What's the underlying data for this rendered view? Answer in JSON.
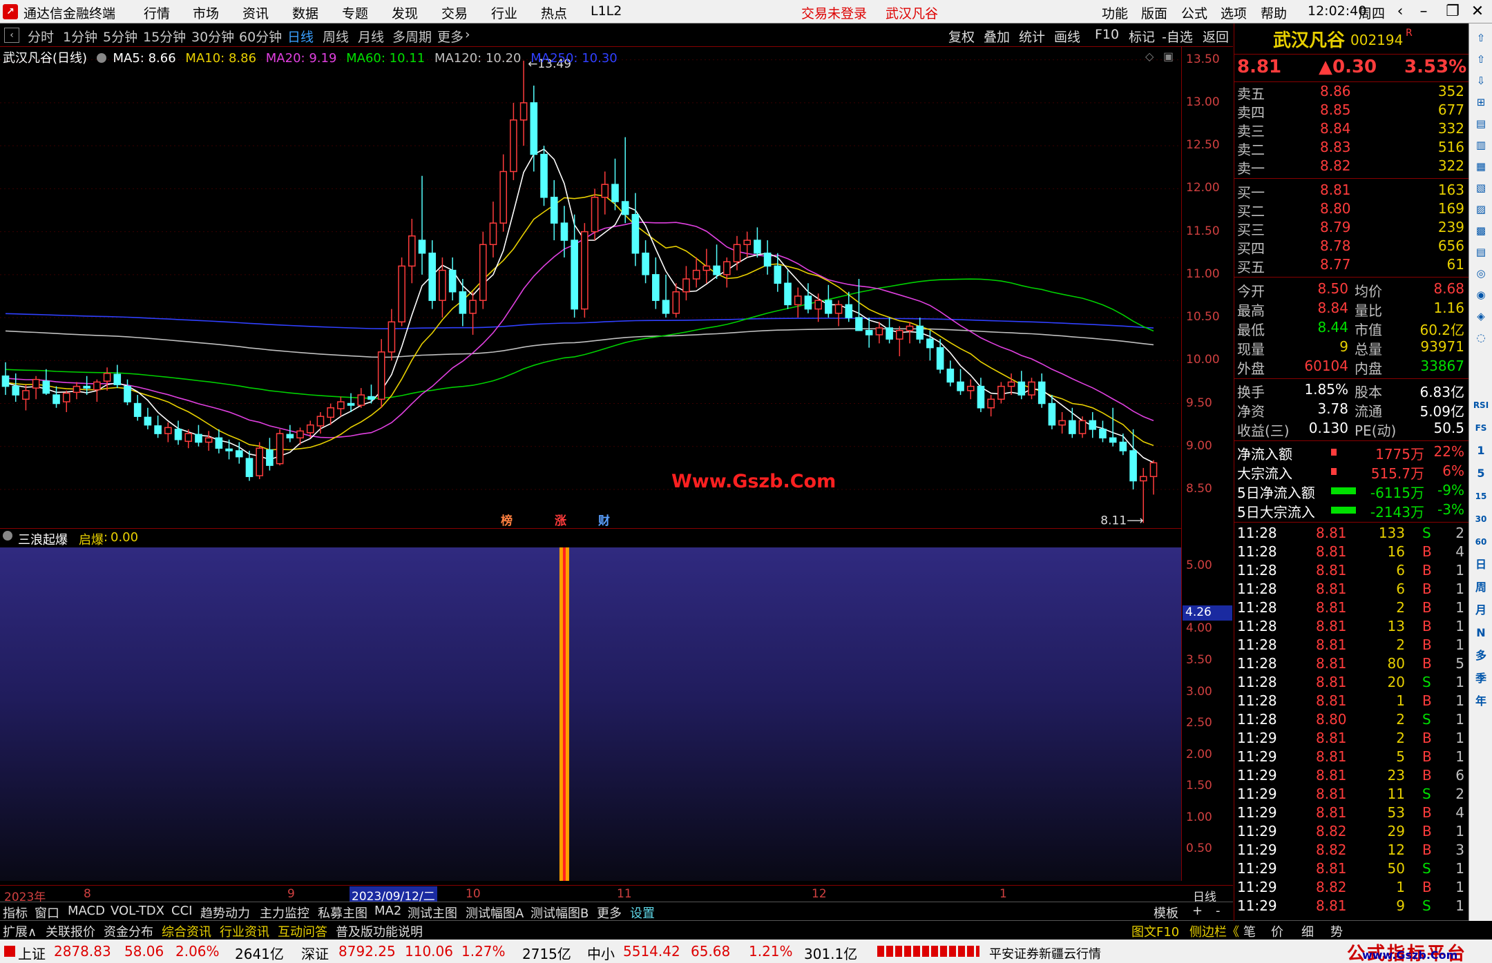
{
  "app": {
    "title": "通达信金融终端",
    "login_status": "交易未登录",
    "stock_name_menu": "武汉凡谷",
    "time": "12:02:40",
    "weekday": "周四"
  },
  "menu": [
    "行情",
    "市场",
    "资讯",
    "数据",
    "专题",
    "发现",
    "交易",
    "行业",
    "热点",
    "L1L2"
  ],
  "menu_right": [
    "功能",
    "版面",
    "公式",
    "选项",
    "帮助"
  ],
  "periods": [
    "分时",
    "1分钟",
    "5分钟",
    "15分钟",
    "30分钟",
    "60分钟",
    "日线",
    "周线",
    "月线",
    "多周期",
    "更多"
  ],
  "active_period": "日线",
  "toolbar_right": [
    "复权",
    "叠加",
    "统计",
    "画线",
    "F10",
    "标记",
    "-自选",
    "返回"
  ],
  "legend": {
    "title": "武汉凡谷(日线)",
    "ma5": "MA5: 8.66",
    "ma10": "MA10: 8.86",
    "ma20": "MA20: 9.19",
    "ma60": "MA60: 10.11",
    "ma120": "MA120: 10.20",
    "ma250": "MA250: 10.30"
  },
  "colors": {
    "up": "#ff3c3c",
    "down": "#54ffff",
    "ma5": "#ffffff",
    "ma10": "#e8d000",
    "ma20": "#e040e0",
    "ma60": "#00d000",
    "ma120": "#c0c0c0",
    "ma250": "#3040ff",
    "indicator_bar": "#ffa000"
  },
  "chart_data": {
    "type": "candlestick",
    "yticks": [
      "13.50",
      "13.00",
      "12.50",
      "12.00",
      "11.50",
      "11.00",
      "10.50",
      "10.00",
      "9.50",
      "9.00",
      "8.50"
    ],
    "ylim": [
      8.05,
      13.65
    ],
    "high_label": "13.49",
    "low_label": "8.11",
    "watermark": "Www.Gszb.Com",
    "markers": [
      {
        "text": "榜",
        "color": "#ff8040"
      },
      {
        "text": "涨",
        "color": "#ff3c3c"
      },
      {
        "text": "财",
        "color": "#5aa0ff"
      }
    ],
    "ohlc": [
      [
        9.82,
        9.98,
        9.6,
        9.7
      ],
      [
        9.7,
        9.85,
        9.52,
        9.6
      ],
      [
        9.55,
        9.72,
        9.42,
        9.65
      ],
      [
        9.68,
        9.82,
        9.55,
        9.78
      ],
      [
        9.76,
        9.9,
        9.6,
        9.62
      ],
      [
        9.6,
        9.7,
        9.45,
        9.5
      ],
      [
        9.52,
        9.65,
        9.4,
        9.62
      ],
      [
        9.63,
        9.75,
        9.55,
        9.7
      ],
      [
        9.7,
        9.82,
        9.6,
        9.68
      ],
      [
        9.66,
        9.78,
        9.52,
        9.75
      ],
      [
        9.76,
        9.92,
        9.65,
        9.85
      ],
      [
        9.84,
        9.95,
        9.68,
        9.72
      ],
      [
        9.7,
        9.78,
        9.48,
        9.52
      ],
      [
        9.5,
        9.6,
        9.3,
        9.35
      ],
      [
        9.34,
        9.45,
        9.2,
        9.25
      ],
      [
        9.24,
        9.36,
        9.1,
        9.15
      ],
      [
        9.15,
        9.28,
        9.05,
        9.22
      ],
      [
        9.2,
        9.3,
        9.02,
        9.08
      ],
      [
        9.06,
        9.2,
        8.98,
        9.15
      ],
      [
        9.14,
        9.25,
        9.0,
        9.05
      ],
      [
        9.05,
        9.18,
        8.95,
        9.1
      ],
      [
        9.1,
        9.2,
        8.92,
        8.98
      ],
      [
        8.97,
        9.08,
        8.85,
        8.95
      ],
      [
        8.95,
        9.05,
        8.8,
        8.88
      ],
      [
        8.86,
        8.95,
        8.6,
        8.65
      ],
      [
        8.66,
        9.05,
        8.62,
        8.98
      ],
      [
        8.96,
        9.1,
        8.72,
        8.78
      ],
      [
        8.8,
        9.2,
        8.78,
        9.15
      ],
      [
        9.14,
        9.25,
        9.05,
        9.1
      ],
      [
        9.1,
        9.22,
        9.02,
        9.18
      ],
      [
        9.16,
        9.3,
        9.1,
        9.25
      ],
      [
        9.24,
        9.4,
        9.15,
        9.35
      ],
      [
        9.34,
        9.5,
        9.25,
        9.45
      ],
      [
        9.44,
        9.58,
        9.35,
        9.52
      ],
      [
        9.5,
        9.62,
        9.4,
        9.48
      ],
      [
        9.48,
        9.68,
        9.45,
        9.6
      ],
      [
        9.58,
        9.72,
        9.5,
        9.55
      ],
      [
        9.55,
        10.25,
        9.45,
        10.1
      ],
      [
        10.1,
        10.6,
        10.0,
        10.45
      ],
      [
        10.45,
        11.2,
        10.4,
        11.1
      ],
      [
        11.1,
        11.65,
        10.9,
        11.45
      ],
      [
        11.4,
        12.15,
        11.0,
        11.25
      ],
      [
        11.25,
        11.4,
        10.6,
        10.7
      ],
      [
        10.7,
        11.2,
        10.5,
        11.05
      ],
      [
        11.05,
        11.2,
        10.7,
        10.8
      ],
      [
        10.8,
        10.95,
        10.4,
        10.55
      ],
      [
        10.55,
        10.8,
        10.3,
        10.7
      ],
      [
        10.7,
        11.5,
        10.6,
        11.35
      ],
      [
        11.35,
        11.85,
        11.2,
        11.6
      ],
      [
        11.6,
        12.4,
        11.5,
        12.2
      ],
      [
        12.2,
        13.0,
        12.1,
        12.8
      ],
      [
        12.8,
        13.49,
        12.5,
        13.0
      ],
      [
        13.0,
        13.2,
        12.2,
        12.4
      ],
      [
        12.4,
        12.5,
        11.8,
        11.9
      ],
      [
        11.9,
        12.1,
        11.4,
        11.6
      ],
      [
        11.6,
        11.8,
        11.2,
        11.4
      ],
      [
        11.4,
        11.7,
        10.5,
        10.6
      ],
      [
        10.6,
        11.6,
        10.5,
        11.5
      ],
      [
        11.5,
        12.0,
        11.4,
        11.9
      ],
      [
        11.9,
        12.2,
        11.7,
        12.05
      ],
      [
        12.05,
        12.35,
        11.75,
        11.85
      ],
      [
        11.85,
        12.6,
        11.6,
        11.7
      ],
      [
        11.7,
        11.95,
        11.1,
        11.25
      ],
      [
        11.25,
        11.4,
        10.9,
        11.0
      ],
      [
        11.0,
        11.2,
        10.6,
        10.7
      ],
      [
        10.7,
        11.0,
        10.5,
        10.55
      ],
      [
        10.55,
        10.9,
        10.5,
        10.8
      ],
      [
        10.8,
        11.1,
        10.7,
        10.95
      ],
      [
        10.95,
        11.2,
        10.85,
        11.05
      ],
      [
        11.05,
        11.3,
        10.9,
        11.1
      ],
      [
        11.1,
        11.35,
        10.95,
        11.0
      ],
      [
        11.0,
        11.2,
        10.85,
        11.15
      ],
      [
        11.15,
        11.45,
        11.05,
        11.35
      ],
      [
        11.35,
        11.5,
        11.2,
        11.4
      ],
      [
        11.4,
        11.55,
        11.2,
        11.25
      ],
      [
        11.25,
        11.4,
        11.0,
        11.1
      ],
      [
        11.1,
        11.25,
        10.8,
        10.9
      ],
      [
        10.9,
        11.05,
        10.6,
        10.65
      ],
      [
        10.65,
        10.85,
        10.5,
        10.75
      ],
      [
        10.75,
        10.9,
        10.55,
        10.6
      ],
      [
        10.6,
        10.78,
        10.45,
        10.7
      ],
      [
        10.7,
        10.88,
        10.5,
        10.55
      ],
      [
        10.55,
        10.7,
        10.4,
        10.65
      ],
      [
        10.65,
        10.8,
        10.45,
        10.5
      ],
      [
        10.5,
        10.95,
        10.4,
        10.35
      ],
      [
        10.35,
        10.5,
        10.15,
        10.3
      ],
      [
        10.3,
        10.45,
        10.2,
        10.38
      ],
      [
        10.38,
        10.5,
        10.2,
        10.25
      ],
      [
        10.25,
        10.4,
        10.05,
        10.35
      ],
      [
        10.35,
        10.45,
        10.2,
        10.4
      ],
      [
        10.4,
        10.5,
        10.2,
        10.25
      ],
      [
        10.25,
        10.35,
        10.0,
        10.15
      ],
      [
        10.15,
        10.25,
        9.85,
        9.9
      ],
      [
        9.9,
        10.0,
        9.7,
        9.75
      ],
      [
        9.75,
        9.9,
        9.6,
        9.65
      ],
      [
        9.65,
        9.78,
        9.55,
        9.7
      ],
      [
        9.7,
        9.8,
        9.4,
        9.45
      ],
      [
        9.45,
        9.6,
        9.35,
        9.55
      ],
      [
        9.55,
        9.75,
        9.5,
        9.7
      ],
      [
        9.7,
        9.85,
        9.6,
        9.75
      ],
      [
        9.75,
        9.88,
        9.55,
        9.6
      ],
      [
        9.6,
        9.8,
        9.55,
        9.75
      ],
      [
        9.75,
        9.85,
        9.45,
        9.5
      ],
      [
        9.5,
        9.6,
        9.2,
        9.25
      ],
      [
        9.25,
        9.4,
        9.15,
        9.3
      ],
      [
        9.3,
        9.45,
        9.1,
        9.15
      ],
      [
        9.15,
        9.35,
        9.1,
        9.3
      ],
      [
        9.3,
        9.4,
        9.1,
        9.2
      ],
      [
        9.2,
        9.3,
        9.05,
        9.1
      ],
      [
        9.1,
        9.45,
        9.0,
        9.05
      ],
      [
        9.05,
        9.15,
        8.9,
        8.95
      ],
      [
        8.95,
        9.2,
        8.5,
        8.6
      ],
      [
        8.6,
        8.75,
        8.11,
        8.65
      ],
      [
        8.65,
        8.84,
        8.44,
        8.81
      ]
    ],
    "indicator": {
      "name": "三浪起爆",
      "label": "启爆",
      "value": "0.00",
      "yticks": [
        "5.00",
        "4.00",
        "3.50",
        "3.00",
        "2.50",
        "2.00",
        "1.50",
        "1.00",
        "0.50"
      ],
      "current_label": "4.26",
      "current_value": 4.26,
      "ylim": [
        0,
        5.3
      ],
      "signal_index": 55
    }
  },
  "xaxis": {
    "labels": [
      "2023年",
      "8",
      "9",
      "2023/09/12/二",
      "10",
      "11",
      "12",
      "1"
    ],
    "period": "日线"
  },
  "indicator_tabs": [
    "指标",
    "窗口",
    "MACD",
    "VOL-TDX",
    "CCI",
    "趋势动力",
    "主力监控",
    "私募主图",
    "MA2",
    "测试主图",
    "测试幅图A",
    "测试幅图B",
    "更多",
    "设置"
  ],
  "indicator_tabs_right": [
    "模板",
    "+",
    "-"
  ],
  "bottom_tabs": [
    "扩展∧",
    "关联报价",
    "资金分布",
    "综合资讯",
    "行业资讯",
    "互动问答",
    "普及版功能说明"
  ],
  "bottom_tabs_right": [
    "图文F10",
    "侧边栏《",
    "笔",
    "价",
    "细",
    "势"
  ],
  "status": {
    "sh": {
      "label": "上证",
      "price": "2878.83",
      "chg": "58.06",
      "pct": "2.06%",
      "amt": "2641亿"
    },
    "sz": {
      "label": "深证",
      "price": "8792.25",
      "chg": "110.06",
      "pct": "1.27%",
      "amt": "2715亿"
    },
    "zx": {
      "label": "中小",
      "price": "5514.42",
      "chg": "65.68",
      "pct": "1.21%",
      "amt": "301.1亿"
    },
    "broker": "平安证券新疆云行情",
    "watermark": "公式指标平台",
    "watermark_url": "www.Gszb.Com"
  },
  "quote": {
    "name": "武汉凡谷",
    "code": "002194",
    "flag": "R",
    "price": "8.81",
    "change": "▲0.30",
    "pct": "3.53%",
    "asks": [
      [
        "卖五",
        "8.86",
        "352"
      ],
      [
        "卖四",
        "8.85",
        "677"
      ],
      [
        "卖三",
        "8.84",
        "332"
      ],
      [
        "卖二",
        "8.83",
        "516"
      ],
      [
        "卖一",
        "8.82",
        "322"
      ]
    ],
    "bids": [
      [
        "买一",
        "8.81",
        "163"
      ],
      [
        "买二",
        "8.80",
        "169"
      ],
      [
        "买三",
        "8.79",
        "239"
      ],
      [
        "买四",
        "8.78",
        "656"
      ],
      [
        "买五",
        "8.77",
        "61"
      ]
    ],
    "stats": [
      [
        "今开",
        "8.50",
        "均价",
        "8.68"
      ],
      [
        "最高",
        "8.84",
        "量比",
        "1.16"
      ],
      [
        "最低",
        "8.44",
        "市值",
        "60.2亿"
      ],
      [
        "现量",
        "9",
        "总量",
        "93971"
      ],
      [
        "外盘",
        "60104",
        "内盘",
        "33867"
      ]
    ],
    "stats2": [
      [
        "换手",
        "1.85%",
        "股本",
        "6.83亿"
      ],
      [
        "净资",
        "3.78",
        "流通",
        "5.09亿"
      ],
      [
        "收益(三)",
        "0.130",
        "PE(动)",
        "50.5"
      ]
    ],
    "flows": [
      [
        "净流入额",
        "1775万",
        "22%"
      ],
      [
        "大宗流入",
        "515.7万",
        "6%"
      ],
      [
        "5日净流入额",
        "-6115万",
        "-9%"
      ],
      [
        "5日大宗流入",
        "-2143万",
        "-3%"
      ]
    ],
    "ticks": [
      [
        "11:28",
        "8.81",
        "133",
        "S",
        "2"
      ],
      [
        "11:28",
        "8.81",
        "16",
        "B",
        "4"
      ],
      [
        "11:28",
        "8.81",
        "6",
        "B",
        "1"
      ],
      [
        "11:28",
        "8.81",
        "6",
        "B",
        "1"
      ],
      [
        "11:28",
        "8.81",
        "2",
        "B",
        "1"
      ],
      [
        "11:28",
        "8.81",
        "13",
        "B",
        "1"
      ],
      [
        "11:28",
        "8.81",
        "2",
        "B",
        "1"
      ],
      [
        "11:28",
        "8.81",
        "80",
        "B",
        "5"
      ],
      [
        "11:28",
        "8.81",
        "20",
        "S",
        "1"
      ],
      [
        "11:28",
        "8.81",
        "1",
        "B",
        "1"
      ],
      [
        "11:28",
        "8.80",
        "2",
        "S",
        "1"
      ],
      [
        "11:29",
        "8.81",
        "2",
        "B",
        "1"
      ],
      [
        "11:29",
        "8.81",
        "5",
        "B",
        "1"
      ],
      [
        "11:29",
        "8.81",
        "23",
        "B",
        "6"
      ],
      [
        "11:29",
        "8.81",
        "11",
        "S",
        "2"
      ],
      [
        "11:29",
        "8.81",
        "53",
        "B",
        "4"
      ],
      [
        "11:29",
        "8.82",
        "29",
        "B",
        "1"
      ],
      [
        "11:29",
        "8.82",
        "12",
        "B",
        "3"
      ],
      [
        "11:29",
        "8.81",
        "50",
        "S",
        "1"
      ],
      [
        "11:29",
        "8.82",
        "1",
        "B",
        "1"
      ],
      [
        "11:29",
        "8.81",
        "9",
        "S",
        "1"
      ]
    ]
  },
  "toolstrip": [
    "RSI",
    "FS",
    "1",
    "5",
    "15",
    "30",
    "60",
    "日",
    "周",
    "月",
    "N",
    "多",
    "季",
    "年"
  ]
}
